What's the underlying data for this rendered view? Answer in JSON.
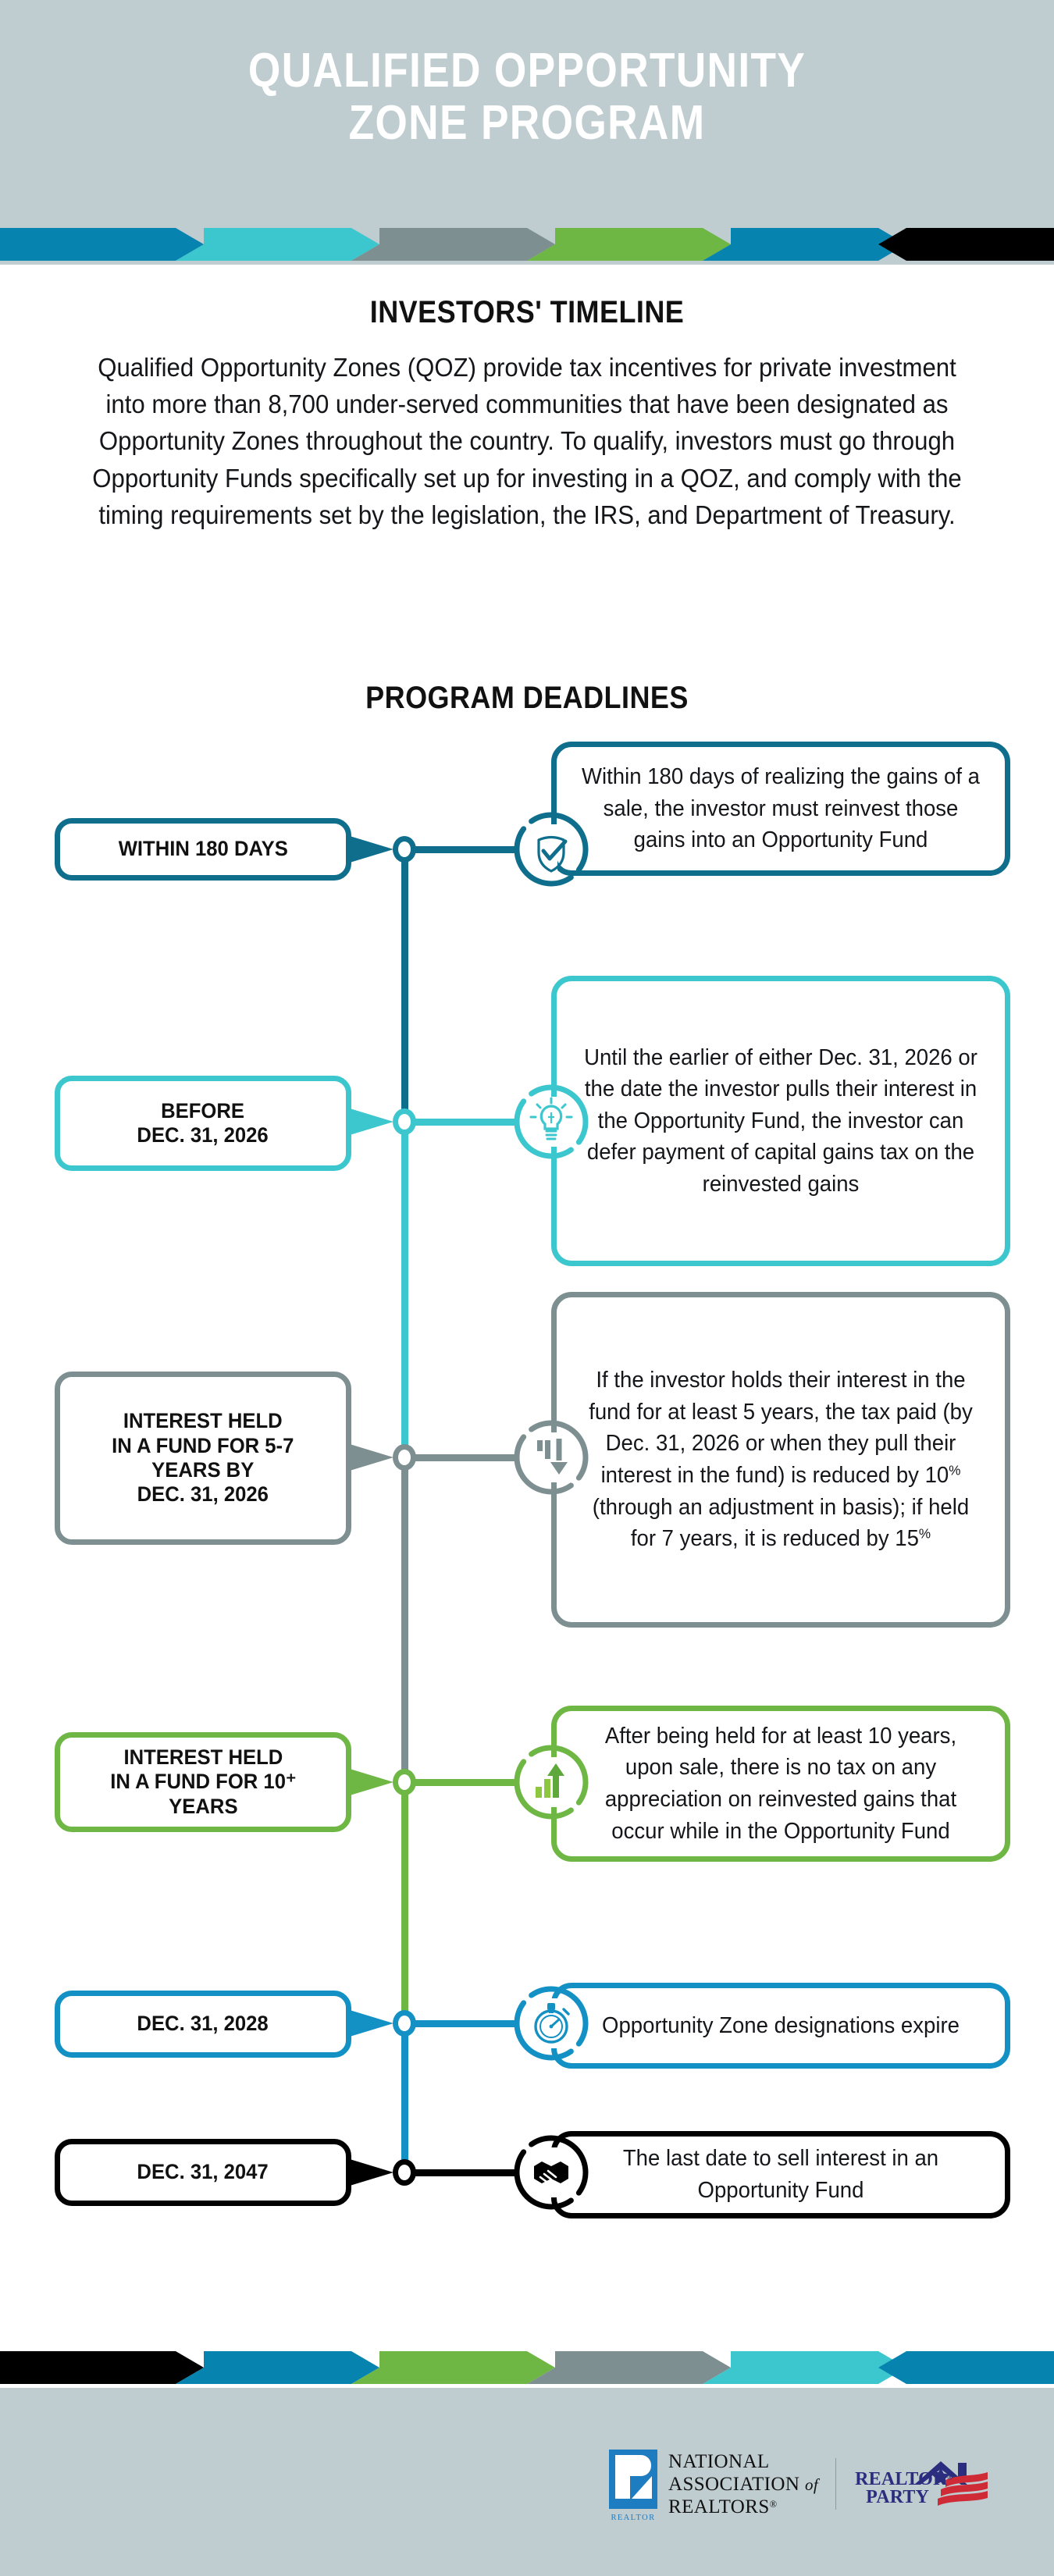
{
  "header": {
    "title": "QUALIFIED OPPORTUNITY\nZONE PROGRAM",
    "bg_color": "#BFCCD0",
    "title_color": "#FFFFFF"
  },
  "chevron_band_top": {
    "colors": [
      "#0783AF",
      "#3CC6CE",
      "#7D8F90",
      "#6EB744",
      "#0783AF",
      "#000000"
    ]
  },
  "chevron_band_bottom": {
    "colors": [
      "#000000",
      "#0783AF",
      "#6EB744",
      "#7D8F90",
      "#3CC6CE",
      "#0783AF"
    ]
  },
  "investors": {
    "heading": "INVESTORS' TIMELINE",
    "paragraph": "Qualified Opportunity Zones (QOZ) provide tax incentives for private investment into more than 8,700 under-served communities that have been designated as Opportunity Zones throughout the country. To qualify, investors must go through Opportunity Funds specifically set up for investing in a QOZ, and comply with the timing requirements set by the legislation, the IRS, and Department of Treasury."
  },
  "deadlines": {
    "heading": "PROGRAM DEADLINES",
    "items": [
      {
        "label": "WITHIN 180 DAYS",
        "description": "Within 180 days of realizing the gains of a sale, the investor must reinvest those gains into an Opportunity Fund",
        "icon": "shield-check-icon",
        "color": "#0E6E8C"
      },
      {
        "label": "BEFORE\nDEC. 31, 2026",
        "description": "Until the earlier of either Dec. 31, 2026 or the date the investor pulls their interest in the Opportunity Fund, the investor can defer payment of capital gains tax on the reinvested gains",
        "icon": "lightbulb-icon",
        "color": "#3CC6CE"
      },
      {
        "label": "INTEREST HELD\nIN A FUND FOR 5-7\nYEARS BY\nDEC. 31, 2026",
        "description": "If the investor holds their interest in the fund for at least 5 years, the tax paid (by Dec. 31, 2026 or when they pull their interest in the fund) is reduced by 10<sup>%</sup> (through an adjustment in basis); if held for 7 years, it is reduced by 15<sup>%</sup>",
        "icon": "declining-bar-arrow-icon",
        "color": "#7D8F90"
      },
      {
        "label": "INTEREST HELD\nIN A FUND FOR 10⁺\nYEARS",
        "description": "After being held for at least 10 years, upon sale, there is no tax on any appreciation on reinvested gains that occur while in the Opportunity Fund",
        "icon": "rising-bar-arrow-icon",
        "color": "#6EB744"
      },
      {
        "label": "DEC. 31, 2028",
        "description": "Opportunity Zone designations expire",
        "icon": "stopwatch-icon",
        "color": "#1391C4"
      },
      {
        "label": "DEC. 31, 2047",
        "description": "The last date to sell interest in an Opportunity Fund",
        "icon": "handshake-icon",
        "color": "#000000"
      }
    ]
  },
  "footer": {
    "nar_logo": {
      "mark_text": "REALTOR",
      "line1": "NATIONAL",
      "line2": "ASSOCIATION",
      "line2_italic": "of",
      "line3": "REALTORS",
      "registered": "®"
    },
    "realtor_party_logo": {
      "line1": "REALTOR",
      "line2": "PARTY",
      "registered": "®"
    }
  }
}
